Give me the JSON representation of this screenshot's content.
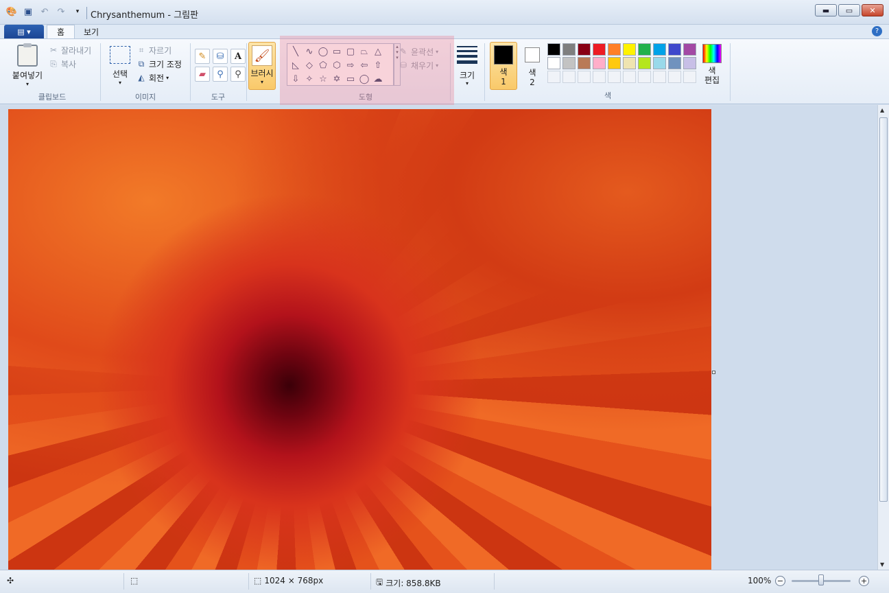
{
  "window": {
    "title": "Chrysanthemum - 그림판",
    "minimize_icon": "minimize-icon",
    "maximize_icon": "maximize-icon",
    "close_icon": "close-icon"
  },
  "tabs": {
    "home": "홈",
    "view": "보기"
  },
  "clipboard": {
    "paste": "붙여넣기",
    "cut": "잘라내기",
    "copy": "복사",
    "label": "클립보드"
  },
  "image": {
    "select": "선택",
    "crop": "자르기",
    "resize": "크기 조정",
    "rotate": "회전",
    "label": "이미지"
  },
  "tools": {
    "label": "도구",
    "text_glyph": "A"
  },
  "brushes": {
    "label": "브러시"
  },
  "shapes": {
    "outline": "윤곽선",
    "fill": "채우기",
    "label": "도형"
  },
  "size": {
    "label": "크기"
  },
  "colors": {
    "color1_label": "색",
    "color1_num": "1",
    "color2_label": "색",
    "color2_num": "2",
    "edit_label": "색",
    "edit_label2": "편집",
    "label": "색",
    "color1": "#000000",
    "color2": "#ffffff",
    "palette_row1": [
      "#000000",
      "#7f7f7f",
      "#880015",
      "#ed1c24",
      "#ff7f27",
      "#fff200",
      "#22b14c",
      "#00a2e8",
      "#3f48cc",
      "#a349a4"
    ],
    "palette_row2": [
      "#ffffff",
      "#c3c3c3",
      "#b97a57",
      "#ffaec9",
      "#ffc90e",
      "#efe4b0",
      "#b5e61d",
      "#99d9ea",
      "#7092be",
      "#c8bfe7"
    ]
  },
  "status": {
    "dimensions": "1024 × 768px",
    "filesize": "크기: 858.8KB",
    "zoom": "100%"
  },
  "canvas": {
    "image": "Chrysanthemum"
  }
}
